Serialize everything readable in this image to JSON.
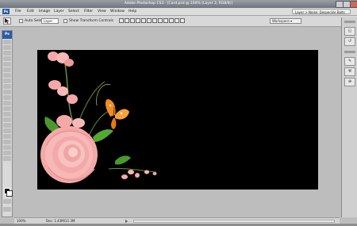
{
  "window": {
    "title": "Adobe Photoshop CS3 - [Card.psd @ 100% (Layer 2, RGB/8)]"
  },
  "menubar": {
    "logo": "Ps",
    "items": [
      "File",
      "Edit",
      "Image",
      "Layer",
      "Select",
      "Filter",
      "View",
      "Window",
      "Help"
    ],
    "workspace_path": "Layer > Noise: Despeckle Balts"
  },
  "options": {
    "auto_select_label": "Auto Select:",
    "auto_select_value": "Layer",
    "show_transform_label": "Show Transform Controls",
    "workspace_label": "Workspace ▾"
  },
  "toolbox": {
    "logo": "Ps"
  },
  "status": {
    "zoom": "100%",
    "doc_size": "Doc: 1.43M/11.3M"
  },
  "colors": {
    "canvas_bg": "#000000",
    "rose": "#f4a9a8",
    "butterfly": "#f28c1e",
    "leaf": "#4a9a2a"
  },
  "icons": {
    "move_tool": "move-icon",
    "foreground_color": "fg-swatch",
    "background_color": "bg-swatch"
  }
}
